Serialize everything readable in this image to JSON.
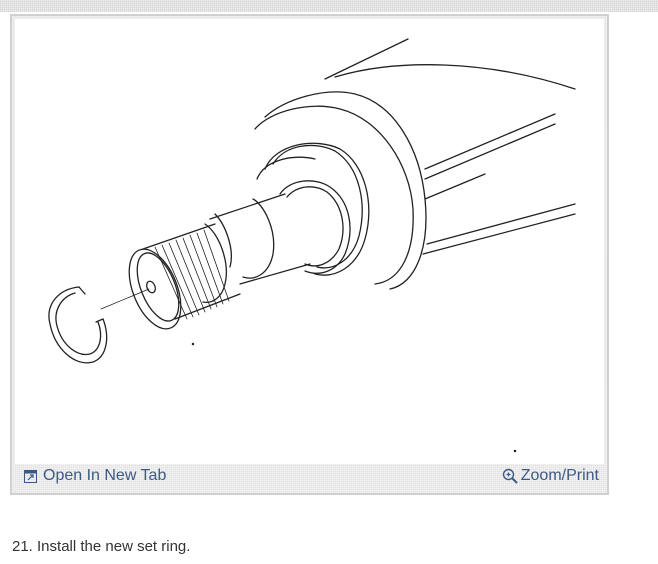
{
  "figure": {
    "open_tab_label": "Open In New Tab",
    "open_tab_icon": "open-in-new-tab-icon",
    "zoom_label": "Zoom/Print",
    "zoom_icon": "zoom-magnifier-icon",
    "link_color": "#3c5a84"
  },
  "step": {
    "text": "21. Install the new set ring."
  }
}
